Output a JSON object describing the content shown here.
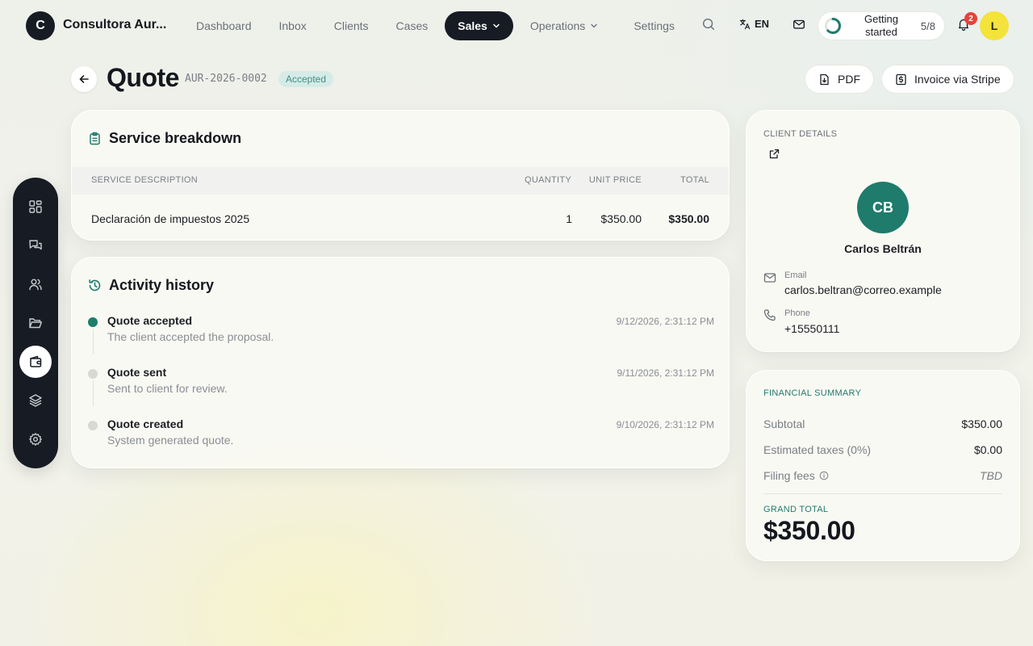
{
  "org": {
    "initial": "C",
    "name": "Consultora Aur..."
  },
  "nav": [
    {
      "label": "Dashboard"
    },
    {
      "label": "Inbox"
    },
    {
      "label": "Clients"
    },
    {
      "label": "Cases"
    },
    {
      "label": "Sales",
      "active": true,
      "dropdown": true
    },
    {
      "label": "Operations",
      "dropdown": true
    },
    {
      "label": "Settings"
    }
  ],
  "topbar": {
    "language": "EN",
    "getting_started": {
      "label": "Getting started",
      "count": "5/8",
      "progress": 0.625
    },
    "notifications_count": "2",
    "user_initial": "L",
    "colors": {
      "avatar": "#f3e33b",
      "badge": "#e5443a",
      "accent": "#1f7b6c"
    }
  },
  "rail": {
    "items": [
      {
        "icon": "dashboard-grid-icon"
      },
      {
        "icon": "chat-bubbles-icon"
      },
      {
        "icon": "users-icon"
      },
      {
        "icon": "folder-icon"
      },
      {
        "icon": "wallet-icon",
        "active": true
      },
      {
        "icon": "layers-icon"
      },
      {
        "icon": "gear-icon"
      }
    ]
  },
  "page": {
    "title": "Quote",
    "number": "AUR-2026-0002",
    "status": "Accepted",
    "actions": {
      "pdf": "PDF",
      "invoice": "Invoice via Stripe"
    }
  },
  "services": {
    "title": "Service breakdown",
    "columns": {
      "description": "SERVICE DESCRIPTION",
      "quantity": "QUANTITY",
      "unit_price": "UNIT PRICE",
      "total": "TOTAL"
    },
    "rows": [
      {
        "description": "Declaración de impuestos 2025",
        "quantity": "1",
        "unit_price": "$350.00",
        "total": "$350.00"
      }
    ]
  },
  "activity": {
    "title": "Activity history",
    "items": [
      {
        "title": "Quote accepted",
        "description": "The client accepted the proposal.",
        "time": "9/12/2026, 2:31:12 PM",
        "current": true
      },
      {
        "title": "Quote sent",
        "description": "Sent to client for review.",
        "time": "9/11/2026, 2:31:12 PM"
      },
      {
        "title": "Quote created",
        "description": "System generated quote.",
        "time": "9/10/2026, 2:31:12 PM"
      }
    ]
  },
  "client": {
    "section_label": "CLIENT DETAILS",
    "initials": "CB",
    "name": "Carlos Beltrán",
    "email_label": "Email",
    "email": "carlos.beltran@correo.example",
    "phone_label": "Phone",
    "phone": "+15550111"
  },
  "financial": {
    "section_label": "FINANCIAL SUMMARY",
    "subtotal_label": "Subtotal",
    "subtotal": "$350.00",
    "taxes_label": "Estimated taxes (0%)",
    "taxes": "$0.00",
    "fees_label": "Filing fees",
    "fees": "TBD",
    "grand_total_label": "GRAND TOTAL",
    "grand_total": "$350.00"
  }
}
